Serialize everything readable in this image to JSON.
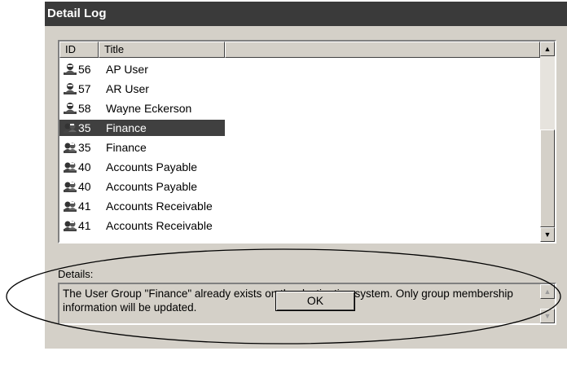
{
  "window": {
    "title": "Detail Log"
  },
  "list": {
    "columns": [
      {
        "label": "ID"
      },
      {
        "label": "Title"
      },
      {
        "label": ""
      }
    ],
    "rows": [
      {
        "id": "56",
        "title": "AP User",
        "icon": "user-icon",
        "selected": false
      },
      {
        "id": "57",
        "title": "AR User",
        "icon": "user-icon",
        "selected": false
      },
      {
        "id": "58",
        "title": "Wayne Eckerson",
        "icon": "user-icon",
        "selected": false
      },
      {
        "id": "35",
        "title": "Finance",
        "icon": "group-icon",
        "selected": true
      },
      {
        "id": "35",
        "title": "Finance",
        "icon": "group-icon",
        "selected": false
      },
      {
        "id": "40",
        "title": "Accounts Payable",
        "icon": "group-icon",
        "selected": false
      },
      {
        "id": "40",
        "title": "Accounts Payable",
        "icon": "group-icon",
        "selected": false
      },
      {
        "id": "41",
        "title": "Accounts Receivable",
        "icon": "group-icon",
        "selected": false
      },
      {
        "id": "41",
        "title": "Accounts Receivable",
        "icon": "group-icon",
        "selected": false
      }
    ]
  },
  "details": {
    "label": "Details:",
    "text": "The User Group \"Finance\" already exists on the destination system.  Only group membership information will be updated."
  },
  "buttons": {
    "ok": "OK"
  },
  "colors": {
    "selection": "#404040",
    "titlebar": "#3a3a3a",
    "face": "#d4d0c8"
  }
}
